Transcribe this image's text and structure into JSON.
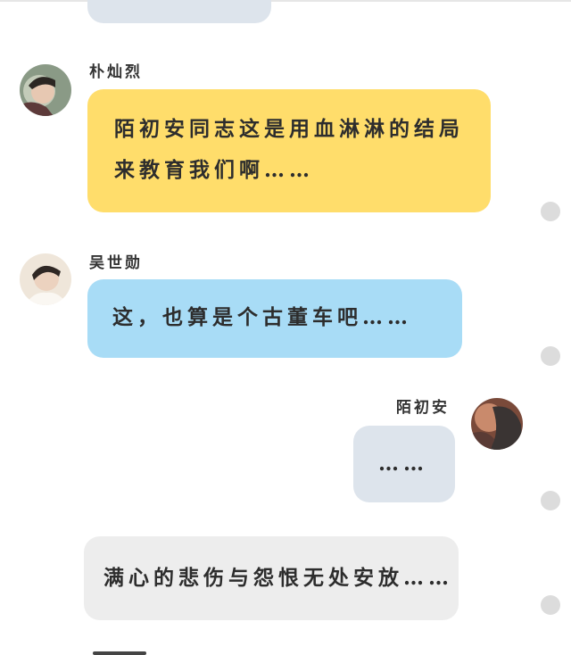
{
  "colors": {
    "bubble_yellow": "#ffdd6b",
    "bubble_blue": "#a8dcf6",
    "bubble_gray_blue": "#dde4ec",
    "bubble_gray": "#ededed",
    "dot": "#dcdcdc"
  },
  "messages": [
    {
      "sender": "朴灿烈",
      "text": "陌初安同志这是用血淋淋的结局来教育我们啊……",
      "side": "left"
    },
    {
      "sender": "吴世勋",
      "text": "这，也算是个古董车吧……",
      "side": "left"
    },
    {
      "sender": "陌初安",
      "text": "……",
      "side": "right"
    },
    {
      "sender": "",
      "text": "满心的悲伤与怨恨无处安放……",
      "side": "narration"
    }
  ]
}
